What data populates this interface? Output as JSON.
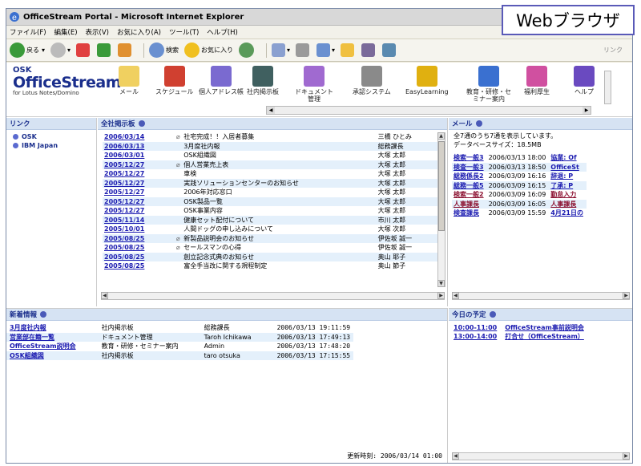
{
  "window": {
    "title": "OfficeStream Portal - Microsoft Internet Explorer"
  },
  "overlay_label": "Webブラウザ",
  "menu": [
    "ファイル(F)",
    "編集(E)",
    "表示(V)",
    "お気に入り(A)",
    "ツール(T)",
    "ヘルプ(H)"
  ],
  "toolbar": {
    "back": "戻る",
    "search": "検索",
    "favorites": "お気に入り",
    "links": "リンク"
  },
  "brand": {
    "company": "OSK",
    "name": "OfficeStream",
    "sub": "for Lotus Notes/Domino"
  },
  "apps": [
    {
      "label": "メール",
      "color": "#f0d060"
    },
    {
      "label": "スケジュール",
      "color": "#d04030"
    },
    {
      "label": "個人アドレス帳",
      "color": "#7a6ad0"
    },
    {
      "label": "社内掲示板",
      "color": "#406060"
    },
    {
      "label": "ドキュメント\n管理",
      "color": "#a06ad0"
    },
    {
      "label": "承認システム",
      "color": "#8a8a8a"
    },
    {
      "label": "EasyLearning",
      "color": "#e0b010"
    },
    {
      "label": "教育・研修・セ\nミナー案内",
      "color": "#3a70d0"
    },
    {
      "label": "福利厚生",
      "color": "#d050a0"
    },
    {
      "label": "ヘルプ",
      "color": "#6a4ac0"
    }
  ],
  "link_panel": {
    "header": "リンク",
    "items": [
      "OSK",
      "IBM Japan"
    ]
  },
  "board": {
    "header": "全社掲示板",
    "rows": [
      {
        "date": "2006/03/14",
        "clip": true,
        "title": "社宅完成！！入居者募集",
        "author": "三橋 ひとみ"
      },
      {
        "date": "2006/03/13",
        "clip": false,
        "title": "3月度社内報",
        "author": "総務課長"
      },
      {
        "date": "2006/03/01",
        "clip": false,
        "title": "OSK組織図",
        "author": "大塚 太郎"
      },
      {
        "date": "2005/12/27",
        "clip": true,
        "title": "個人営業売上表",
        "author": "大塚 太郎"
      },
      {
        "date": "2005/12/27",
        "clip": false,
        "title": "車検",
        "author": "大塚 太郎"
      },
      {
        "date": "2005/12/27",
        "clip": false,
        "title": "実践ソリューションセンターのお知らせ",
        "author": "大塚 太郎"
      },
      {
        "date": "2005/12/27",
        "clip": false,
        "title": "2006年対応窓口",
        "author": "大塚 太郎"
      },
      {
        "date": "2005/12/27",
        "clip": false,
        "title": "OSK製品一覧",
        "author": "大塚 太郎"
      },
      {
        "date": "2005/12/27",
        "clip": false,
        "title": "OSK事業内容",
        "author": "大塚 太郎"
      },
      {
        "date": "2005/11/14",
        "clip": false,
        "title": "健康セット配付について",
        "author": "市川 太郎"
      },
      {
        "date": "2005/10/01",
        "clip": false,
        "title": "人間ドッグの申し込みについて",
        "author": "大塚 次郎"
      },
      {
        "date": "2005/08/25",
        "clip": true,
        "title": "新製品説明会のお知らせ",
        "author": "伊佐坂 誠一"
      },
      {
        "date": "2005/08/25",
        "clip": true,
        "title": "セールスマンの心得",
        "author": "伊佐坂 誠一"
      },
      {
        "date": "2005/08/25",
        "clip": false,
        "title": "創立記念式典のお知らせ",
        "author": "奥山 耶子"
      },
      {
        "date": "2005/08/25",
        "clip": false,
        "title": "富全手当改に関する規程制定",
        "author": "奥山 節子"
      }
    ]
  },
  "mail": {
    "header": "メール",
    "info1": "全7通のうち7通を表示しています。",
    "info2": "データベースサイズ：18.5MB",
    "rows": [
      {
        "from": "検索一般3",
        "red": false,
        "date": "2006/03/13 18:00",
        "subject": "協業: Of"
      },
      {
        "from": "検査一般3",
        "red": false,
        "date": "2006/03/13 18:50",
        "subject": "OfficeSt"
      },
      {
        "from": "総務係長2",
        "red": false,
        "date": "2006/03/09 16:16",
        "subject": "辞退: P"
      },
      {
        "from": "総務一般5",
        "red": false,
        "date": "2006/03/09 16:15",
        "subject": "了承: P"
      },
      {
        "from": "検索一般2",
        "red": true,
        "date": "2006/03/09 16:09",
        "subject": "勤怠入力"
      },
      {
        "from": "人事課長",
        "red": true,
        "date": "2006/03/09 16:05",
        "subject": "人事課長"
      },
      {
        "from": "検査課長",
        "red": false,
        "date": "2006/03/09 15:59",
        "subject": "4月21日の"
      }
    ]
  },
  "new_info": {
    "header": "新着情報",
    "rows": [
      {
        "title": "3月度社内報",
        "category": "社内掲示板",
        "author": "総務課長",
        "datetime": "2006/03/13 19:11:59"
      },
      {
        "title": "営業部在籍一覧",
        "category": "ドキュメント管理",
        "author": "Taroh Ichikawa",
        "datetime": "2006/03/13 17:49:13"
      },
      {
        "title": "OfficeStream説明会",
        "category": "教育・研修・セミナー案内",
        "author": "Admin",
        "datetime": "2006/03/13 17:48:20"
      },
      {
        "title": "OSK組織図",
        "category": "社内掲示板",
        "author": "taro otsuka",
        "datetime": "2006/03/13 17:15:55"
      }
    ],
    "updated": "更新時刻: 2006/03/14 01:00"
  },
  "today": {
    "header": "今日の予定",
    "rows": [
      {
        "time": "10:00-11:00",
        "event": "OfficeStream事前説明会"
      },
      {
        "time": "13:00-14:00",
        "event": "打合せ（OfficeStream）"
      }
    ]
  }
}
